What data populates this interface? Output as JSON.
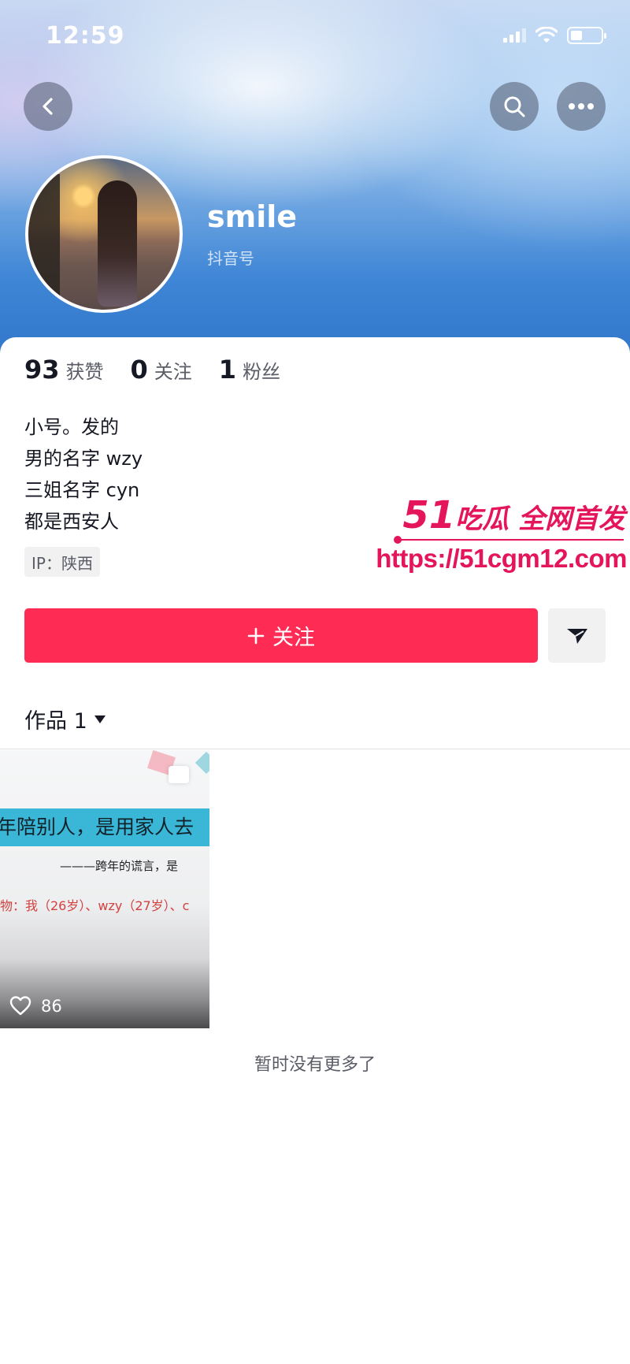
{
  "status_bar": {
    "time": "12:59"
  },
  "profile": {
    "username": "smile",
    "douyin_id_label": "抖音号"
  },
  "stats": [
    {
      "value": "93",
      "label": "获赞"
    },
    {
      "value": "0",
      "label": "关注"
    },
    {
      "value": "1",
      "label": "粉丝"
    }
  ],
  "bio": [
    "小号。发的",
    "男的名字 wzy",
    "三姐名字 cyn",
    "都是西安人"
  ],
  "ip_tag": "IP：陕西",
  "watermark": {
    "num": "51",
    "text": "吃瓜 全网首发",
    "url": "https://51cgm12.com"
  },
  "actions": {
    "follow_label": "关注"
  },
  "works_tab": {
    "label": "作品 1"
  },
  "video": {
    "caption_line1": "年陪别人，是用家人去",
    "caption_line2": "———跨年的谎言，是",
    "caption_line3": "物：我（26岁）、wzy（27岁）、c",
    "likes": "86"
  },
  "footer": {
    "no_more": "暂时没有更多了"
  },
  "colors": {
    "accent": "#fe2c55",
    "watermark": "#e4155b"
  }
}
